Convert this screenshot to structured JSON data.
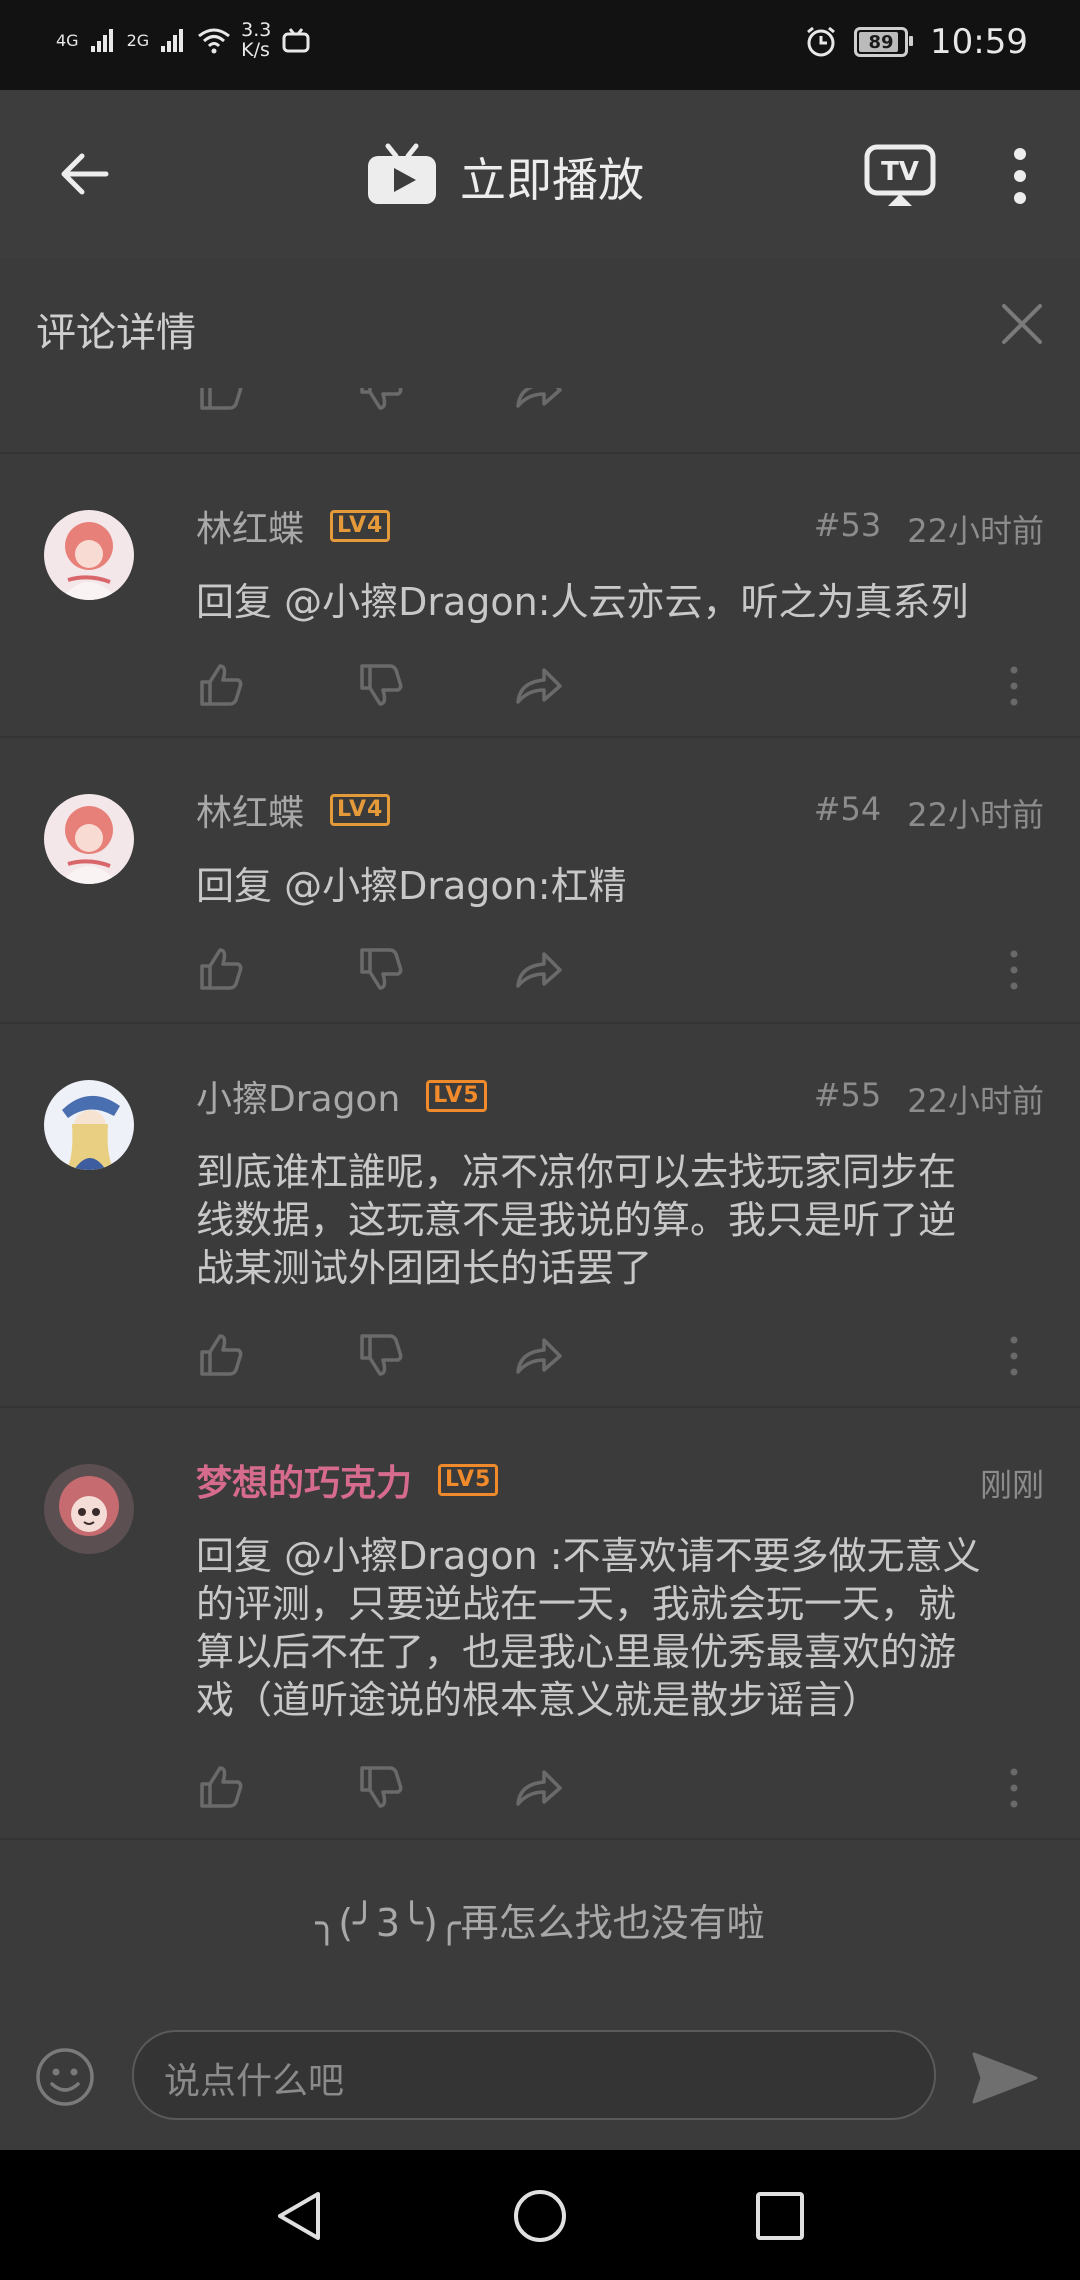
{
  "status_bar": {
    "network_1": "4G",
    "network_2": "2G",
    "speed": "3.3",
    "speed_unit": "K/s",
    "battery": "89",
    "time": "10:59"
  },
  "app_bar": {
    "title": "立即播放"
  },
  "detail_header": {
    "title": "评论详情"
  },
  "comments": [
    {
      "username": "林红蝶",
      "level": "LV4",
      "floor": "#53",
      "time": "22小时前",
      "text": "回复 @小擦Dragon:人云亦云，听之为真系列"
    },
    {
      "username": "林红蝶",
      "level": "LV4",
      "floor": "#54",
      "time": "22小时前",
      "text": "回复 @小擦Dragon:杠精"
    },
    {
      "username": "小擦Dragon",
      "level": "LV5",
      "floor": "#55",
      "time": "22小时前",
      "text_lines": [
        "到底谁杠誰呢，凉不凉你可以去找玩家同步在",
        "线数据，这玩意不是我说的算。我只是听了逆",
        "战某测试外团团长的话罢了"
      ]
    },
    {
      "username": "梦想的巧克力",
      "level": "LV5",
      "time": "刚刚",
      "text_lines": [
        "回复 @小擦Dragon :不喜欢请不要多做无意义",
        "的评测，只要逆战在一天，我就会玩一天，就",
        "算以后不在了，也是我心里最优秀最喜欢的游",
        "戏（道听途说的根本意义就是散步谣言）"
      ]
    }
  ],
  "footer": {
    "end_message": "╮(╯3╰)╭再怎么找也没有啦"
  },
  "input_bar": {
    "placeholder": "说点什么吧"
  },
  "colors": {
    "background": "#3b3b3b",
    "status_bar": "#121212",
    "level_badge": "#e59a3a",
    "highlight_username": "#d66b8d"
  }
}
